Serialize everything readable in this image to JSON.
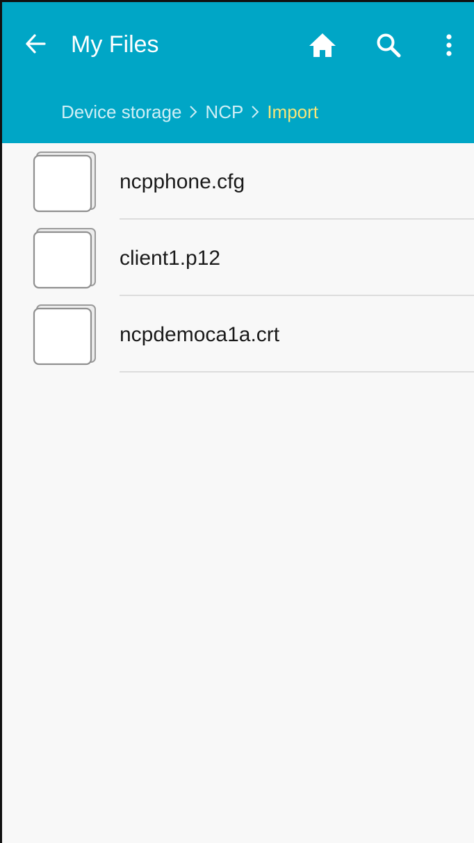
{
  "header": {
    "title": "My Files",
    "back_icon": "arrow-left-icon",
    "actions": [
      {
        "name": "home",
        "icon": "home-icon"
      },
      {
        "name": "search",
        "icon": "search-icon"
      },
      {
        "name": "more",
        "icon": "more-vertical-icon"
      }
    ]
  },
  "breadcrumb": {
    "items": [
      "Device storage",
      "NCP"
    ],
    "current": "Import",
    "separator_icon": "chevron-right-icon"
  },
  "files": [
    {
      "name": "ncpphone.cfg",
      "icon": "file-icon"
    },
    {
      "name": "client1.p12",
      "icon": "file-icon"
    },
    {
      "name": "ncpdemoca1a.crt",
      "icon": "file-icon"
    }
  ],
  "colors": {
    "appbar": "#00a6c6",
    "current_crumb": "#f7e67a",
    "crumb": "#cfeff6",
    "background": "#f8f8f8",
    "divider": "#dcdcdc"
  }
}
